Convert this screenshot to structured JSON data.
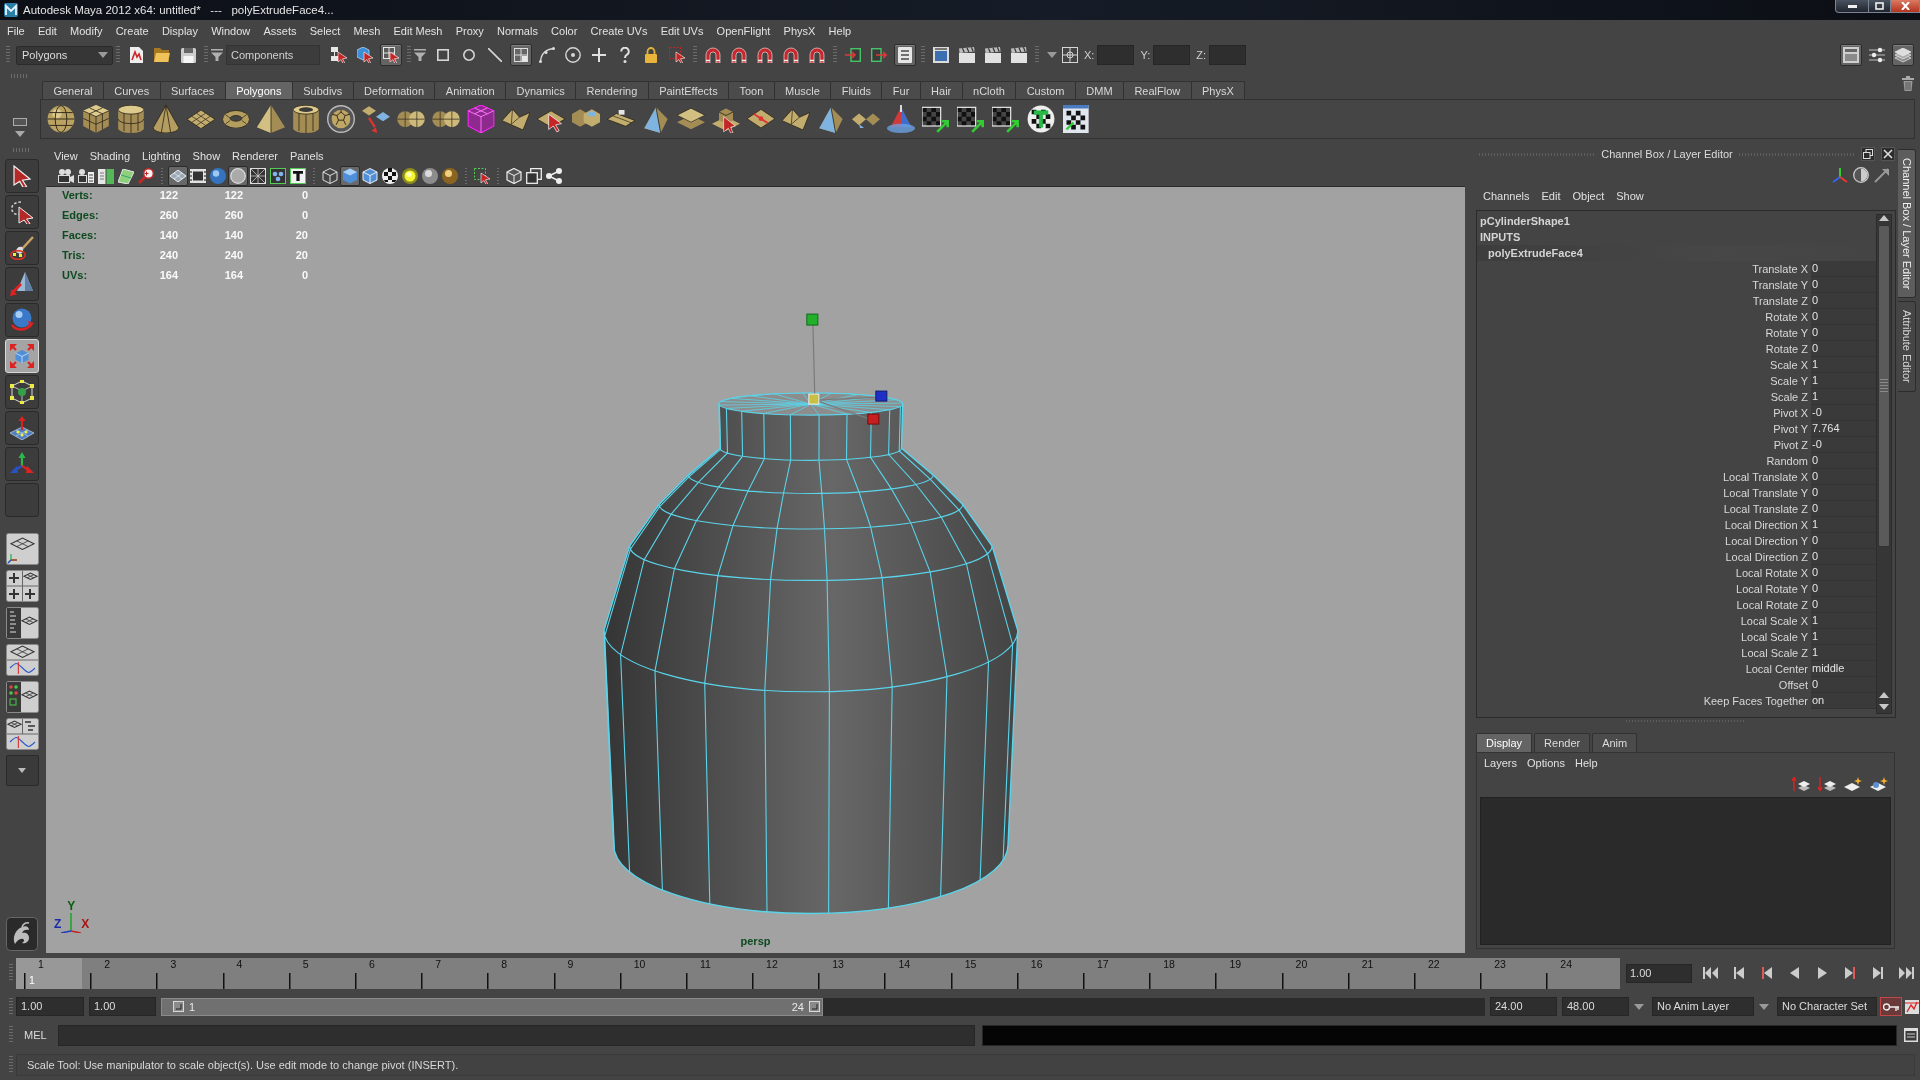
{
  "window": {
    "title": "Autodesk Maya 2012 x64: untitled*   ---   polyExtrudeFace4..."
  },
  "menu_bar": [
    "File",
    "Edit",
    "Modify",
    "Create",
    "Display",
    "Window",
    "Assets",
    "Select",
    "Mesh",
    "Edit Mesh",
    "Proxy",
    "Normals",
    "Color",
    "Create UVs",
    "Edit UVs",
    "OpenFlight",
    "PhysX",
    "Help"
  ],
  "status_line": {
    "menu_set": "Polygons",
    "selection_mode": "Components",
    "select_mode_buttons": [
      {
        "on": false
      },
      {
        "on": false
      },
      {
        "on": true
      }
    ],
    "pick_mask_buttons": [
      {
        "on": false
      },
      {
        "on": false
      },
      {
        "on": false
      },
      {
        "on": true
      },
      {
        "on": false
      },
      {
        "on": false
      },
      {
        "on": false
      },
      {
        "on": false
      },
      {
        "on": false
      },
      {
        "on": false
      }
    ],
    "history_buttons": [
      {
        "on": false
      },
      {
        "on": false
      },
      {
        "on": true
      }
    ],
    "transform_fields": [
      {
        "label": "X:"
      },
      {
        "label": "Y:"
      },
      {
        "label": "Z:"
      }
    ],
    "panel_buttons": [
      {
        "on": true
      },
      {
        "on": false
      },
      {
        "on": true
      }
    ]
  },
  "shelf": {
    "tabs": [
      {
        "label": "General",
        "selected": false
      },
      {
        "label": "Curves",
        "selected": false
      },
      {
        "label": "Surfaces",
        "selected": false
      },
      {
        "label": "Polygons",
        "selected": true
      },
      {
        "label": "Subdivs",
        "selected": false
      },
      {
        "label": "Deformation",
        "selected": false
      },
      {
        "label": "Animation",
        "selected": false
      },
      {
        "label": "Dynamics",
        "selected": false
      },
      {
        "label": "Rendering",
        "selected": false
      },
      {
        "label": "PaintEffects",
        "selected": false
      },
      {
        "label": "Toon",
        "selected": false
      },
      {
        "label": "Muscle",
        "selected": false
      },
      {
        "label": "Fluids",
        "selected": false
      },
      {
        "label": "Fur",
        "selected": false
      },
      {
        "label": "Hair",
        "selected": false
      },
      {
        "label": "nCloth",
        "selected": false
      },
      {
        "label": "Custom",
        "selected": false
      },
      {
        "label": "DMM",
        "selected": false
      },
      {
        "label": "RealFlow",
        "selected": false
      },
      {
        "label": "PhysX",
        "selected": false
      }
    ]
  },
  "tools": [
    {
      "selected": false
    },
    {
      "selected": false
    },
    {
      "selected": false
    },
    {
      "selected": false
    },
    {
      "selected": false
    },
    {
      "selected": true
    },
    {
      "selected": false
    },
    {
      "selected": false
    },
    {
      "selected": false
    },
    {
      "selected": false
    }
  ],
  "viewport": {
    "menus": [
      "View",
      "Shading",
      "Lighting",
      "Show",
      "Renderer",
      "Panels"
    ],
    "toolbar_buttons": [
      {
        "on": false
      },
      {
        "on": false
      },
      {
        "on": false
      },
      {
        "on": false
      },
      {
        "on": false
      },
      {
        "on": true
      },
      {
        "on": false
      },
      {
        "on": false
      },
      {
        "on": true
      },
      {
        "on": false
      },
      {
        "on": false
      },
      {
        "on": false
      },
      {
        "on": false
      },
      {
        "on": true
      },
      {
        "on": false
      },
      {
        "on": false
      },
      {
        "on": false
      },
      {
        "on": false
      },
      {
        "on": false
      },
      {
        "on": false
      },
      {
        "on": false
      },
      {
        "on": false
      },
      {
        "on": false
      }
    ],
    "heads_up": [
      {
        "label": "Verts:",
        "values": [
          "122",
          "122",
          "0"
        ]
      },
      {
        "label": "Edges:",
        "values": [
          "260",
          "260",
          "0"
        ]
      },
      {
        "label": "Faces:",
        "values": [
          "140",
          "140",
          "20"
        ]
      },
      {
        "label": "Tris:",
        "values": [
          "240",
          "240",
          "20"
        ]
      },
      {
        "label": "UVs:",
        "values": [
          "164",
          "164",
          "0"
        ]
      }
    ],
    "axis_labels": [
      "Y",
      "Z",
      "X"
    ],
    "camera": "persp"
  },
  "channel_box": {
    "title": "Channel Box / Layer Editor",
    "menus": [
      "Channels",
      "Edit",
      "Object",
      "Show"
    ],
    "shape": "pCylinderShape1",
    "section": "INPUTS",
    "node": "polyExtrudeFace4",
    "attributes": [
      {
        "name": "Translate X",
        "value": "0"
      },
      {
        "name": "Translate Y",
        "value": "0"
      },
      {
        "name": "Translate Z",
        "value": "0"
      },
      {
        "name": "Rotate X",
        "value": "0"
      },
      {
        "name": "Rotate Y",
        "value": "0"
      },
      {
        "name": "Rotate Z",
        "value": "0"
      },
      {
        "name": "Scale X",
        "value": "1"
      },
      {
        "name": "Scale Y",
        "value": "1"
      },
      {
        "name": "Scale Z",
        "value": "1"
      },
      {
        "name": "Pivot X",
        "value": "-0"
      },
      {
        "name": "Pivot Y",
        "value": "7.764"
      },
      {
        "name": "Pivot Z",
        "value": "-0"
      },
      {
        "name": "Random",
        "value": "0"
      },
      {
        "name": "Local Translate X",
        "value": "0"
      },
      {
        "name": "Local Translate Y",
        "value": "0"
      },
      {
        "name": "Local Translate Z",
        "value": "0"
      },
      {
        "name": "Local Direction X",
        "value": "1"
      },
      {
        "name": "Local Direction Y",
        "value": "0"
      },
      {
        "name": "Local Direction Z",
        "value": "0"
      },
      {
        "name": "Local Rotate X",
        "value": "0"
      },
      {
        "name": "Local Rotate Y",
        "value": "0"
      },
      {
        "name": "Local Rotate Z",
        "value": "0"
      },
      {
        "name": "Local Scale X",
        "value": "1"
      },
      {
        "name": "Local Scale Y",
        "value": "1"
      },
      {
        "name": "Local Scale Z",
        "value": "1"
      },
      {
        "name": "Local Center",
        "value": "middle"
      },
      {
        "name": "Offset",
        "value": "0"
      },
      {
        "name": "Keep Faces Together",
        "value": "on"
      }
    ]
  },
  "side_tabs": [
    {
      "label": "Channel Box / Layer Editor",
      "selected": true
    },
    {
      "label": "Attribute Editor",
      "selected": false
    }
  ],
  "layer_editor": {
    "tabs": [
      {
        "label": "Display",
        "selected": true
      },
      {
        "label": "Render",
        "selected": false
      },
      {
        "label": "Anim",
        "selected": false
      }
    ],
    "menus": [
      "Layers",
      "Options",
      "Help"
    ]
  },
  "time_slider": {
    "frames": [
      {
        "label": "1",
        "selected": true
      },
      {
        "label": "2",
        "selected": false
      },
      {
        "label": "3",
        "selected": false
      },
      {
        "label": "4",
        "selected": false
      },
      {
        "label": "5",
        "selected": false
      },
      {
        "label": "6",
        "selected": false
      },
      {
        "label": "7",
        "selected": false
      },
      {
        "label": "8",
        "selected": false
      },
      {
        "label": "9",
        "selected": false
      },
      {
        "label": "10",
        "selected": false
      },
      {
        "label": "11",
        "selected": false
      },
      {
        "label": "12",
        "selected": false
      },
      {
        "label": "13",
        "selected": false
      },
      {
        "label": "14",
        "selected": false
      },
      {
        "label": "15",
        "selected": false
      },
      {
        "label": "16",
        "selected": false
      },
      {
        "label": "17",
        "selected": false
      },
      {
        "label": "18",
        "selected": false
      },
      {
        "label": "19",
        "selected": false
      },
      {
        "label": "20",
        "selected": false
      },
      {
        "label": "21",
        "selected": false
      },
      {
        "label": "22",
        "selected": false
      },
      {
        "label": "23",
        "selected": false
      },
      {
        "label": "24",
        "selected": false
      }
    ],
    "current_frame": "1",
    "current_time": "1.00"
  },
  "range_slider": {
    "start_time": "1.00",
    "playback_start": "1.00",
    "level": 0.5,
    "range_start": "1",
    "range_end": "24",
    "playback_end": "24.00",
    "end_time": "48.00",
    "anim_layer": "No Anim Layer",
    "character_set": "No Character Set"
  },
  "command_line": {
    "language": "MEL"
  },
  "help_line": "Scale Tool: Use manipulator to scale object(s). Use edit mode to change pivot (INSERT)."
}
